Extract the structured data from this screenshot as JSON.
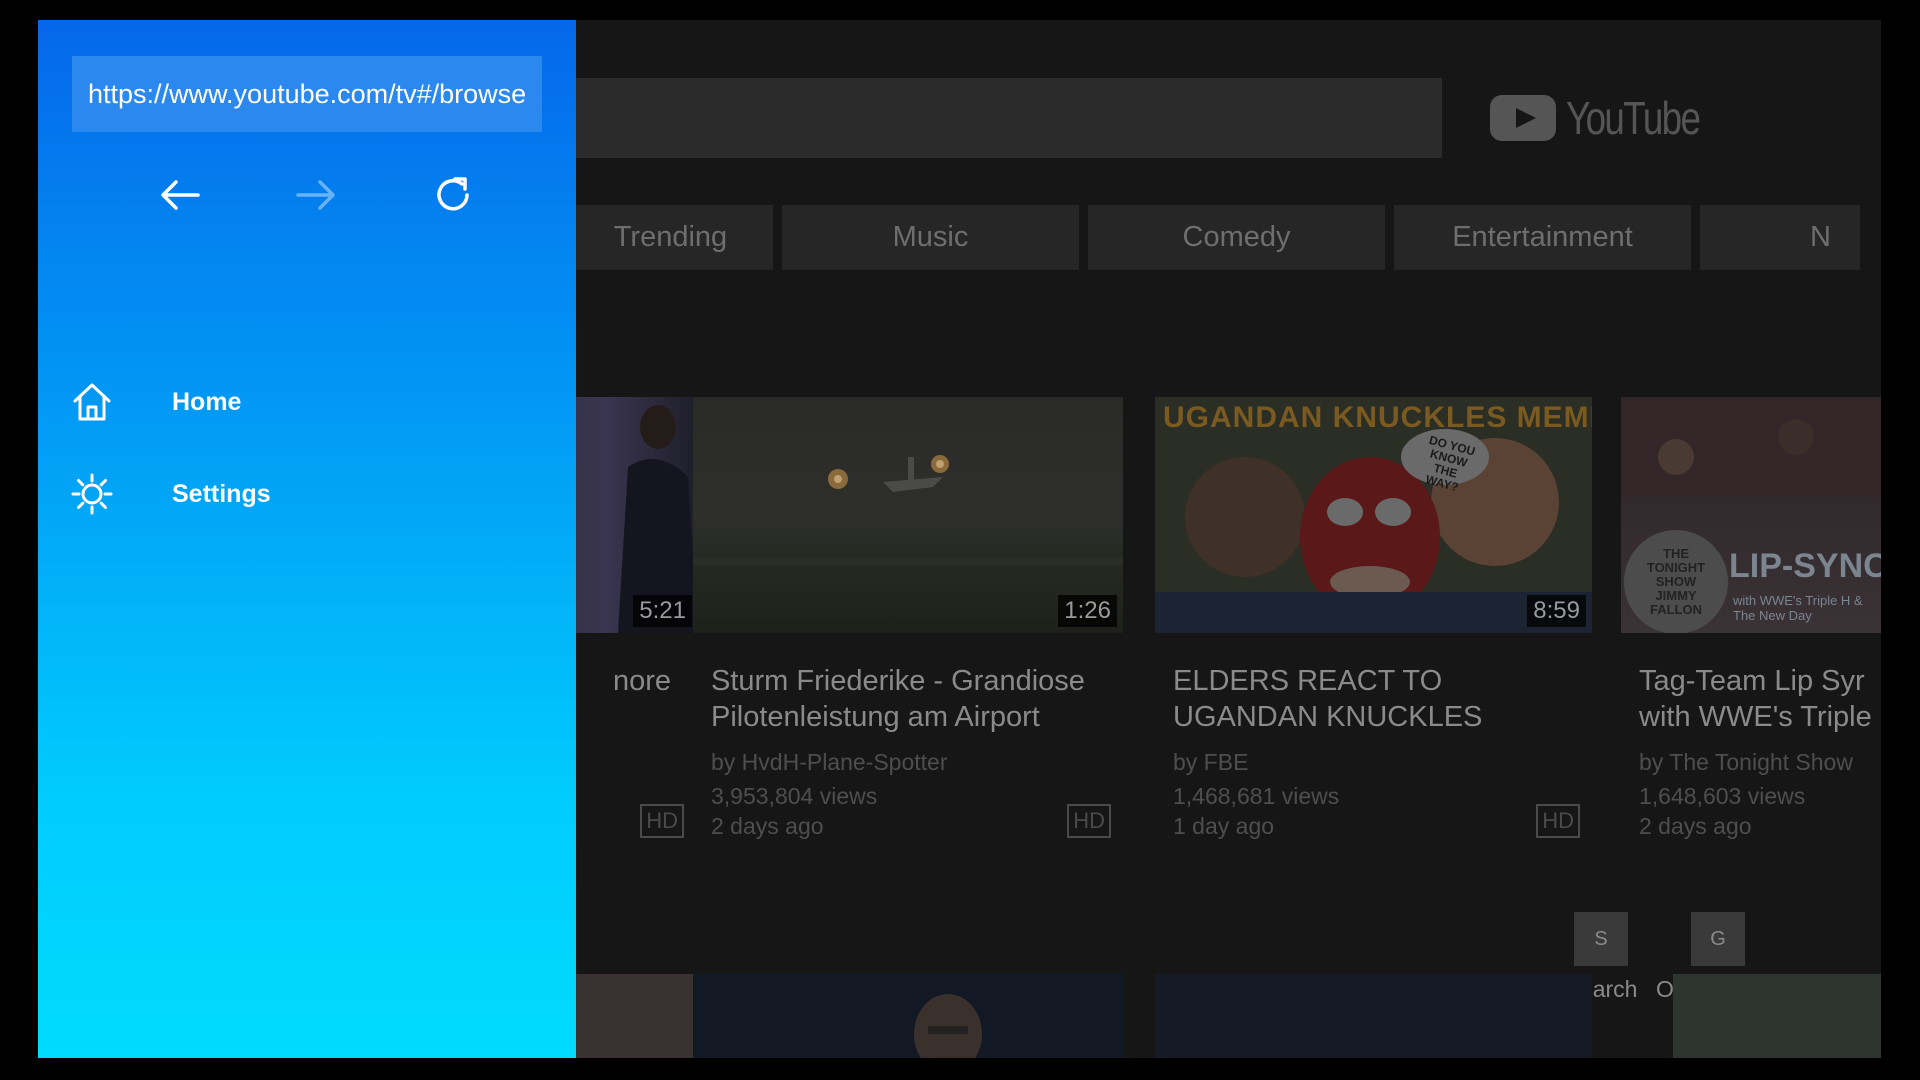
{
  "browser": {
    "url": "https://www.youtube.com/tv#/browse",
    "menu": {
      "home_label": "Home",
      "settings_label": "Settings"
    }
  },
  "youtube": {
    "logo_text": "YouTube",
    "tabs": [
      "Trending",
      "Music",
      "Comedy",
      "Entertainment",
      "N"
    ],
    "videos": [
      {
        "title": "nore",
        "duration": "5:21",
        "badge": "HD"
      },
      {
        "title1": "Sturm Friederike - Grandiose",
        "title2": "Pilotenleistung am Airport",
        "channel": "by HvdH-Plane-Spotter",
        "views": "3,953,804 views",
        "age": "2 days ago",
        "duration": "1:26",
        "badge": "HD"
      },
      {
        "title1": "ELDERS REACT TO",
        "title2": "UGANDAN KNUCKLES",
        "channel": "by FBE",
        "views": "1,468,681 views",
        "age": "1 day ago",
        "duration": "8:59",
        "badge": "HD",
        "thumb_text": "UGANDAN KNUCKLES MEMES",
        "bubble_text": "DO YOU KNOW THE WAY?"
      },
      {
        "title1": "Tag-Team Lip Syr",
        "title2": "with WWE's Triple",
        "channel": "by The Tonight Show",
        "views": "1,648,603 views",
        "age": "2 days ago",
        "thumb_text": "LIP-SYNC",
        "thumb_sub": "with WWE's Triple H & The New Day",
        "show_logo": "THE TONIGHT SHOW JIMMY FALLON"
      }
    ],
    "hints": [
      {
        "key": "S",
        "label": "Search"
      },
      {
        "key": "G",
        "label": "Open Guide"
      }
    ]
  },
  "colors": {
    "sidebar_top": "#0567ea",
    "sidebar_bottom": "#00dbff",
    "url_bg": "#2b88ee"
  }
}
